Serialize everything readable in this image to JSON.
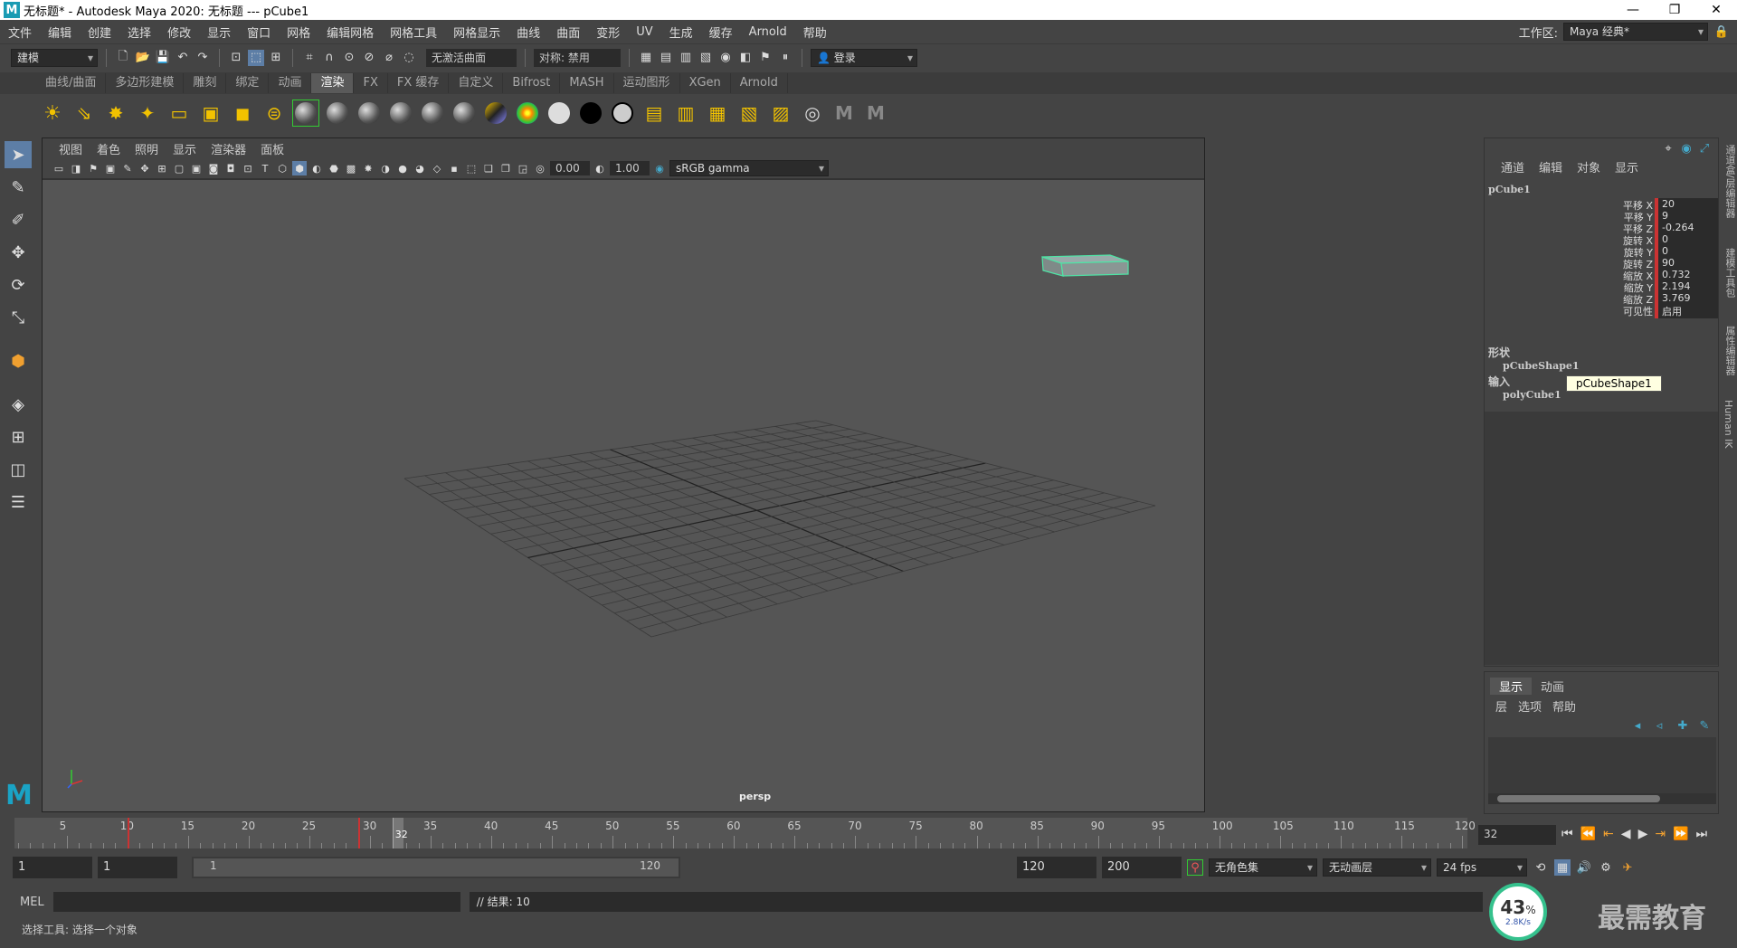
{
  "window": {
    "title": "无标题* - Autodesk Maya 2020: 无标题   ---   pCube1",
    "controls": [
      "—",
      "❐",
      "✕"
    ]
  },
  "menubar": {
    "items": [
      "文件",
      "编辑",
      "创建",
      "选择",
      "修改",
      "显示",
      "窗口",
      "网格",
      "编辑网格",
      "网格工具",
      "网格显示",
      "曲线",
      "曲面",
      "变形",
      "UV",
      "生成",
      "缓存",
      "Arnold",
      "帮助"
    ],
    "workspace_label": "工作区:",
    "workspace_value": "Maya 经典*"
  },
  "statusline": {
    "mode": "建模",
    "live_surface": "无激活曲面",
    "symmetry": "对称: 禁用",
    "login": "登录"
  },
  "shelf": {
    "tabs": [
      "曲线/曲面",
      "多边形建模",
      "雕刻",
      "绑定",
      "动画",
      "渲染",
      "FX",
      "FX 缓存",
      "自定义",
      "Bifrost",
      "MASH",
      "运动图形",
      "XGen",
      "Arnold"
    ],
    "active_tab": "渲染"
  },
  "viewport": {
    "menu": [
      "视图",
      "着色",
      "照明",
      "显示",
      "渲染器",
      "面板"
    ],
    "exposure": "0.00",
    "gamma": "1.00",
    "color_space": "sRGB gamma",
    "camera_label": "persp"
  },
  "channel_box": {
    "menu": [
      "通道",
      "编辑",
      "对象",
      "显示"
    ],
    "object": "pCube1",
    "attributes": [
      {
        "label": "平移 X",
        "value": "20"
      },
      {
        "label": "平移 Y",
        "value": "9"
      },
      {
        "label": "平移 Z",
        "value": "-0.264"
      },
      {
        "label": "旋转 X",
        "value": "0"
      },
      {
        "label": "旋转 Y",
        "value": "0"
      },
      {
        "label": "旋转 Z",
        "value": "90"
      },
      {
        "label": "缩放 X",
        "value": "0.732"
      },
      {
        "label": "缩放 Y",
        "value": "2.194"
      },
      {
        "label": "缩放 Z",
        "value": "3.769"
      },
      {
        "label": "可见性",
        "value": "启用"
      }
    ],
    "shapes_heading": "形状",
    "shape_name": "pCubeShape1",
    "inputs_heading": "输入",
    "input_name": "polyCube1",
    "tooltip": "pCubeShape1"
  },
  "layer_editor": {
    "tabs": [
      "显示",
      "动画"
    ],
    "menu": [
      "层",
      "选项",
      "帮助"
    ]
  },
  "right_tabs": [
    "通道盒/层编辑器",
    "建模工具包",
    "属性编辑器",
    "Human IK"
  ],
  "timeline": {
    "ticks": [
      "5",
      "10",
      "15",
      "20",
      "25",
      "30",
      "35",
      "40",
      "45",
      "50",
      "55",
      "60",
      "65",
      "70",
      "75",
      "80",
      "85",
      "90",
      "95",
      "100",
      "105",
      "110",
      "115",
      "120"
    ],
    "current_frame_label": "32",
    "current_frame": "32"
  },
  "range": {
    "start": "1",
    "anim_start": "1",
    "slider_start": "1",
    "slider_end": "120",
    "anim_end": "120",
    "end": "200",
    "character_set": "无角色集",
    "anim_layer": "无动画层",
    "fps": "24 fps"
  },
  "command": {
    "lang": "MEL",
    "result": "// 结果: 10"
  },
  "help_line": "选择工具: 选择一个对象",
  "perf": {
    "percent": "43",
    "unit": "%",
    "speed": "2.8K/s"
  },
  "watermark": "最需教育",
  "colors": {
    "accent": "#5d7ea6",
    "selection": "#4fe3a5",
    "channel_red": "#cc3333"
  }
}
